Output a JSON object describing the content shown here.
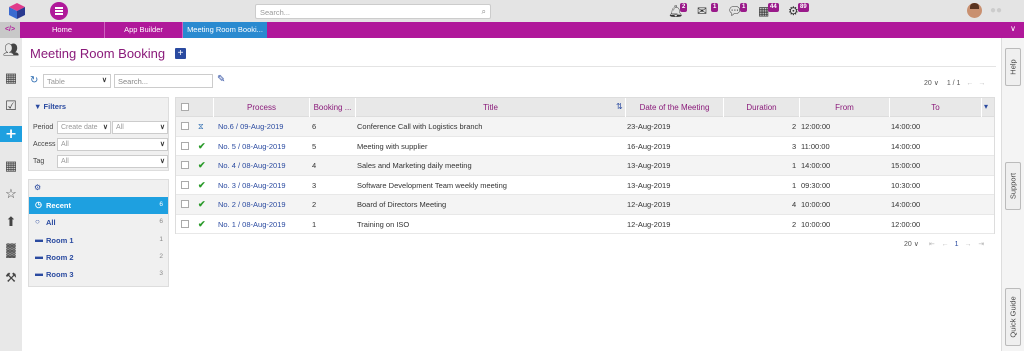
{
  "topbar": {
    "search_placeholder": "Search...",
    "notifications": [
      {
        "icon": "bell-icon",
        "count": "2"
      },
      {
        "icon": "envelope-icon",
        "count": "1"
      },
      {
        "icon": "chat-icon",
        "count": "1"
      },
      {
        "icon": "calendar-icon",
        "count": "44"
      },
      {
        "icon": "gears-icon",
        "count": "89"
      }
    ]
  },
  "tabs": {
    "code": "</>",
    "home": "Home",
    "app_builder": "App Builder",
    "meeting": "Meeting Room Booki..."
  },
  "page": {
    "title": "Meeting Room Booking",
    "view_select": "Table",
    "search_placeholder": "Search...",
    "page_size": "20",
    "page_info": "1 / 1"
  },
  "filters": {
    "title": "Filters",
    "period_label": "Period",
    "period_value": "Create date",
    "period_value2": "All",
    "access_label": "Access",
    "access_value": "All",
    "tag_label": "Tag",
    "tag_value": "All"
  },
  "groups": [
    {
      "label": "Recent",
      "count": "6",
      "icon": "clock-icon",
      "active": true
    },
    {
      "label": "All",
      "count": "6",
      "icon": "circle-icon",
      "active": false
    },
    {
      "label": "Room 1",
      "count": "1",
      "icon": "folder-icon",
      "active": false
    },
    {
      "label": "Room 2",
      "count": "2",
      "icon": "folder-icon",
      "active": false
    },
    {
      "label": "Room 3",
      "count": "3",
      "icon": "folder-icon",
      "active": false
    }
  ],
  "table": {
    "columns": [
      "Process",
      "Booking ...",
      "Title",
      "Date of the Meeting",
      "Duration",
      "From",
      "To"
    ],
    "rows": [
      {
        "status": "waiting",
        "process": "No.6 / 09-Aug-2019",
        "booking": "6",
        "title": "Conference Call with Logistics branch",
        "date": "23-Aug-2019",
        "duration": "2",
        "from": "12:00:00",
        "to": "14:00:00"
      },
      {
        "status": "done",
        "process": "No. 5 / 08-Aug-2019",
        "booking": "5",
        "title": "Meeting with supplier",
        "date": "16-Aug-2019",
        "duration": "3",
        "from": "11:00:00",
        "to": "14:00:00"
      },
      {
        "status": "done",
        "process": "No. 4 / 08-Aug-2019",
        "booking": "4",
        "title": "Sales and Marketing daily meeting",
        "date": "13-Aug-2019",
        "duration": "1",
        "from": "14:00:00",
        "to": "15:00:00"
      },
      {
        "status": "done",
        "process": "No. 3 / 08-Aug-2019",
        "booking": "3",
        "title": "Software Development Team weekly meeting",
        "date": "13-Aug-2019",
        "duration": "1",
        "from": "09:30:00",
        "to": "10:30:00"
      },
      {
        "status": "done",
        "process": "No. 2 / 08-Aug-2019",
        "booking": "2",
        "title": "Board of Directors Meeting",
        "date": "12-Aug-2019",
        "duration": "4",
        "from": "10:00:00",
        "to": "14:00:00"
      },
      {
        "status": "done",
        "process": "No. 1 / 08-Aug-2019",
        "booking": "1",
        "title": "Training on ISO",
        "date": "12-Aug-2019",
        "duration": "2",
        "from": "10:00:00",
        "to": "12:00:00"
      }
    ]
  },
  "bottom_pager": {
    "page_size": "20",
    "page": "1"
  },
  "side_tabs": {
    "help": "Help",
    "support": "Support",
    "quick_guide": "Quick Guide"
  }
}
